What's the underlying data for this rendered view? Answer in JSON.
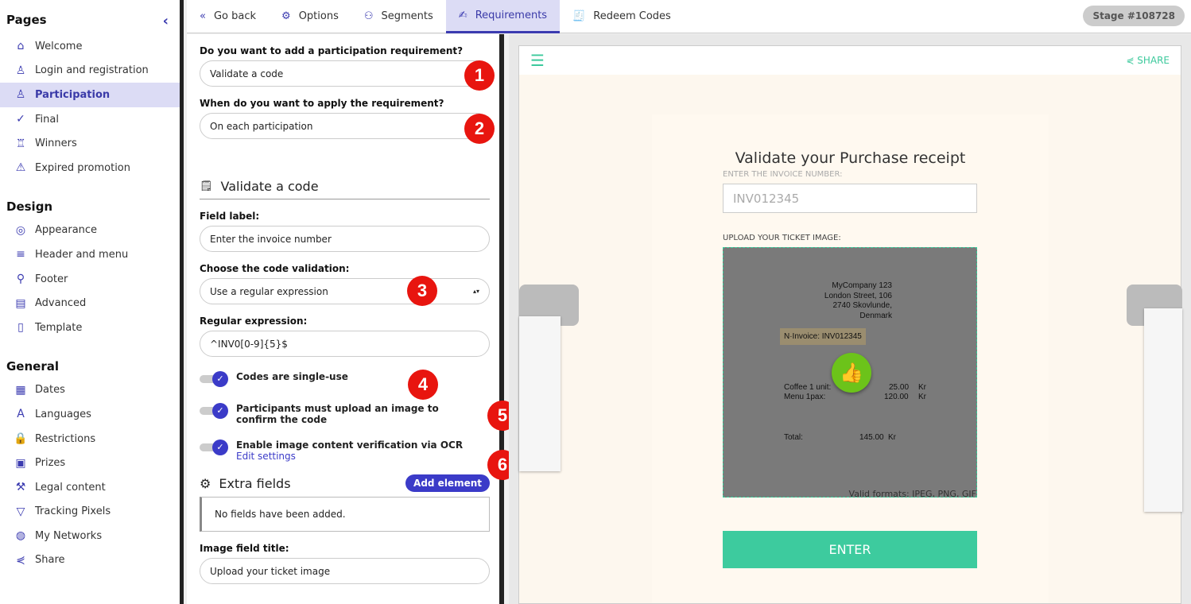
{
  "sidebar": {
    "pages_title": "Pages",
    "design_title": "Design",
    "general_title": "General",
    "pages": [
      {
        "label": "Welcome",
        "icon": "home-icon"
      },
      {
        "label": "Login and registration",
        "icon": "user-icon"
      },
      {
        "label": "Participation",
        "icon": "user-plus-icon",
        "active": true
      },
      {
        "label": "Final",
        "icon": "check-icon"
      },
      {
        "label": "Winners",
        "icon": "trophy-icon"
      },
      {
        "label": "Expired promotion",
        "icon": "warning-icon"
      }
    ],
    "design": [
      {
        "label": "Appearance",
        "icon": "palette-icon"
      },
      {
        "label": "Header and menu",
        "icon": "menu-icon"
      },
      {
        "label": "Footer",
        "icon": "footer-icon"
      },
      {
        "label": "Advanced",
        "icon": "code-icon"
      },
      {
        "label": "Template",
        "icon": "file-icon"
      }
    ],
    "general": [
      {
        "label": "Dates",
        "icon": "calendar-icon"
      },
      {
        "label": "Languages",
        "icon": "translate-icon"
      },
      {
        "label": "Restrictions",
        "icon": "lock-icon"
      },
      {
        "label": "Prizes",
        "icon": "gift-icon"
      },
      {
        "label": "Legal content",
        "icon": "gavel-icon"
      },
      {
        "label": "Tracking Pixels",
        "icon": "filter-icon"
      },
      {
        "label": "My Networks",
        "icon": "globe-icon"
      },
      {
        "label": "Share",
        "icon": "share-icon"
      }
    ]
  },
  "tabs": [
    {
      "label": "Go back"
    },
    {
      "label": "Options"
    },
    {
      "label": "Segments"
    },
    {
      "label": "Requirements",
      "active": true
    },
    {
      "label": "Redeem Codes"
    }
  ],
  "stage": "Stage #108728",
  "form": {
    "q1": "Do you want to add a participation requirement?",
    "q1_value": "Validate a code",
    "q2": "When do you want to apply the requirement?",
    "q2_value": "On each participation",
    "section": "Validate a code",
    "field_label": "Field label:",
    "field_value": "Enter the invoice number",
    "validation_label": "Choose the code validation:",
    "validation_value": "Use a regular expression",
    "regex_label": "Regular expression:",
    "regex_value": "^INV0[0-9]{5}$",
    "toggle1": "Codes are single-use",
    "toggle2": "Participants must upload an image to confirm the code",
    "toggle3": "Enable image content verification via OCR",
    "edit_settings": "Edit settings",
    "extra_title": "Extra fields",
    "add_element": "Add element",
    "no_fields": "No fields have been added.",
    "image_title_label": "Image field title:",
    "image_title_value": "Upload your ticket image"
  },
  "badges": [
    "1",
    "2",
    "3",
    "4",
    "5",
    "6"
  ],
  "preview": {
    "share": "SHARE",
    "title": "Validate your Purchase receipt",
    "input_label": "ENTER THE INVOICE NUMBER:",
    "input_placeholder": "INV012345",
    "upload_label": "UPLOAD YOUR TICKET IMAGE:",
    "receipt": {
      "company": "MyCompany 123",
      "street": "London Street, 106",
      "city": "2740 Skovlunde,",
      "country": "Denmark",
      "invoice": "N·Invoice: INV012345",
      "item1": "Coffee 1 unit:",
      "price1": "25.00",
      "item2": "Menu 1pax:",
      "price2": "120.00",
      "total_label": "Total:",
      "total": "145.00",
      "currency": "Kr"
    },
    "formats": "Valid formats: JPEG, PNG, GIF",
    "enter": "ENTER"
  },
  "colors": {
    "accent": "#3b3bc8",
    "badge": "#e8150f",
    "preview_accent": "#3dcb9e"
  }
}
